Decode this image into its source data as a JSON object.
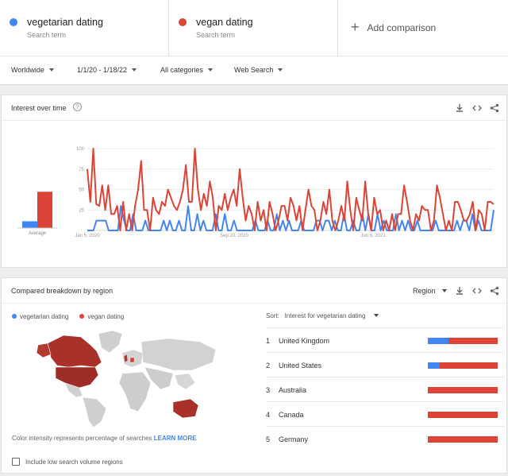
{
  "terms": [
    {
      "name": "vegetarian dating",
      "sub": "Search term",
      "color": "#4285f4"
    },
    {
      "name": "vegan dating",
      "sub": "Search term",
      "color": "#db4437"
    }
  ],
  "add_comparison": "Add comparison",
  "filters": {
    "region": "Worldwide",
    "dates": "1/1/20 - 1/18/22",
    "category": "All categories",
    "search_type": "Web Search"
  },
  "interest_card": {
    "title": "Interest over time",
    "average_label": "Average",
    "icons": [
      "download-icon",
      "embed-icon",
      "share-icon"
    ]
  },
  "chart_data": {
    "type": "line",
    "ylim": [
      0,
      100
    ],
    "y_ticks": [
      "100",
      "75",
      "50",
      "25"
    ],
    "x_tick_labels": [
      "Jan 5, 2020",
      "Sep 20, 2020",
      "Jun 6, 2021"
    ],
    "averages": {
      "vegetarian dating": 6,
      "vegan dating": 32
    },
    "series": [
      {
        "name": "vegetarian dating",
        "color": "#4285f4",
        "values": [
          0,
          0,
          0,
          12,
          12,
          12,
          12,
          0,
          0,
          0,
          0,
          30,
          12,
          0,
          0,
          20,
          0,
          0,
          0,
          12,
          0,
          0,
          0,
          0,
          0,
          12,
          0,
          12,
          0,
          0,
          12,
          0,
          0,
          30,
          0,
          0,
          20,
          0,
          12,
          0,
          0,
          0,
          20,
          0,
          0,
          20,
          0,
          0,
          12,
          0,
          0,
          0,
          0,
          0,
          0,
          12,
          0,
          0,
          0,
          12,
          0,
          0,
          20,
          0,
          12,
          0,
          12,
          0,
          0,
          0,
          12,
          0,
          0,
          0,
          0,
          12,
          12,
          0,
          12,
          12,
          0,
          12,
          0,
          0,
          20,
          0,
          0,
          12,
          0,
          0,
          20,
          0,
          20,
          0,
          0,
          20,
          0,
          12,
          0,
          0,
          0,
          20,
          0,
          12,
          0,
          12,
          0,
          0,
          12,
          0,
          0,
          0,
          0,
          0,
          12,
          0,
          0,
          0,
          0,
          0,
          0,
          12,
          0,
          12,
          12,
          0,
          20,
          0,
          12,
          0,
          0,
          0,
          0,
          25
        ]
      },
      {
        "name": "vegan dating",
        "color": "#db4437",
        "values": [
          75,
          35,
          100,
          32,
          30,
          55,
          25,
          55,
          20,
          20,
          30,
          0,
          35,
          0,
          20,
          0,
          30,
          50,
          85,
          25,
          25,
          0,
          40,
          25,
          20,
          35,
          30,
          50,
          40,
          30,
          25,
          35,
          50,
          80,
          35,
          35,
          100,
          50,
          25,
          45,
          30,
          60,
          40,
          0,
          30,
          25,
          45,
          25,
          40,
          50,
          30,
          75,
          40,
          12,
          30,
          20,
          0,
          35,
          12,
          25,
          0,
          35,
          20,
          0,
          12,
          30,
          30,
          12,
          40,
          30,
          12,
          30,
          0,
          25,
          50,
          30,
          25,
          0,
          12,
          35,
          20,
          50,
          12,
          0,
          12,
          30,
          12,
          60,
          25,
          0,
          40,
          25,
          12,
          60,
          20,
          0,
          40,
          20,
          25,
          0,
          12,
          0,
          20,
          0,
          20,
          20,
          55,
          35,
          12,
          0,
          20,
          12,
          30,
          25,
          25,
          0,
          12,
          55,
          40,
          20,
          0,
          12,
          0,
          35,
          35,
          25,
          12,
          12,
          20,
          35,
          0,
          25,
          20,
          0,
          35,
          35,
          32
        ]
      }
    ]
  },
  "region_card": {
    "title": "Compared breakdown by region",
    "region_select": "Region",
    "legend": [
      "vegetarian dating",
      "vegan dating"
    ],
    "note": "Color intensity represents percentage of searches",
    "learn_more": "LEARN MORE",
    "sort_label": "Sort:",
    "sort_value": "Interest for vegetarian dating",
    "low_volume_label": "Include low search volume regions",
    "regions": [
      {
        "rank": "1",
        "name": "United Kingdom",
        "vegetarian_pct": 30,
        "vegan_pct": 70
      },
      {
        "rank": "2",
        "name": "United States",
        "vegetarian_pct": 17,
        "vegan_pct": 83
      },
      {
        "rank": "3",
        "name": "Australia",
        "vegetarian_pct": 0,
        "vegan_pct": 100
      },
      {
        "rank": "4",
        "name": "Canada",
        "vegetarian_pct": 0,
        "vegan_pct": 100
      },
      {
        "rank": "5",
        "name": "Germany",
        "vegetarian_pct": 0,
        "vegan_pct": 100
      }
    ]
  }
}
